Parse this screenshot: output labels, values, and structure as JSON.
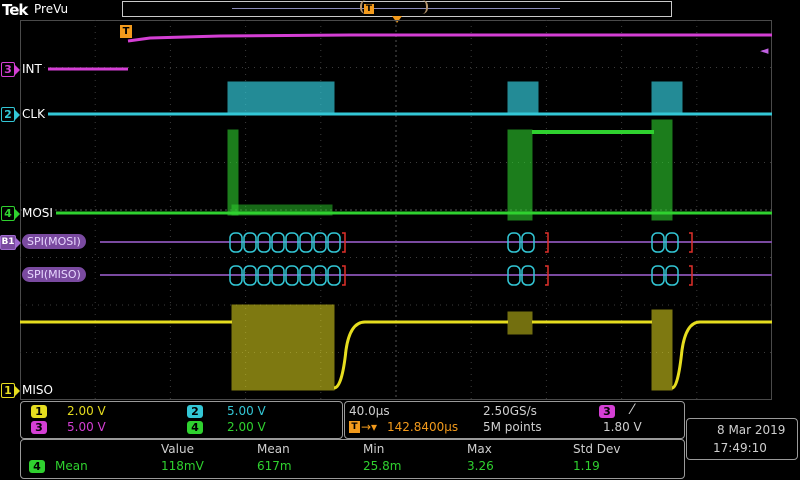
{
  "header": {
    "brand": "Tek",
    "mode": "PreVu",
    "trigger_marker": "T"
  },
  "channels": [
    {
      "id": "3",
      "label": "INT",
      "color": "#d43fd4"
    },
    {
      "id": "2",
      "label": "CLK",
      "color": "#33c7d6"
    },
    {
      "id": "4",
      "label": "MOSI",
      "color": "#2fd12f"
    },
    {
      "id": "1",
      "label": "MISO",
      "color": "#e6dd1f"
    }
  ],
  "bus": {
    "id": "B1",
    "decode_rows": [
      {
        "label": "SPI(MOSI)"
      },
      {
        "label": "SPI(MISO)"
      }
    ]
  },
  "trigger_level_marker": "◄",
  "scale_panel": {
    "ch1": {
      "num": "1",
      "value": "2.00 V",
      "color": "#e6dd1f"
    },
    "ch2": {
      "num": "2",
      "value": "5.00 V",
      "color": "#33c7d6"
    },
    "ch3": {
      "num": "3",
      "value": "5.00 V",
      "color": "#d43fd4"
    },
    "ch4": {
      "num": "4",
      "value": "2.00 V",
      "color": "#2fd12f"
    }
  },
  "timebase": {
    "horizontal_scale": "40.0µs",
    "sample_rate": "2.50GS/s",
    "trigger_position": "142.8400µs",
    "record_length": "5M points",
    "trigger_source": "3",
    "trigger_slope": "⁄",
    "trigger_level": "1.80 V"
  },
  "datetime": {
    "date": "8 Mar  2019",
    "time": "17:49:10"
  },
  "measurements": {
    "headers": [
      "Value",
      "Mean",
      "Min",
      "Max",
      "Std Dev"
    ],
    "row": {
      "source": "4",
      "name": "Mean",
      "values": [
        "118mV",
        "617m",
        "25.8m",
        "3.26",
        "1.19"
      ]
    }
  }
}
